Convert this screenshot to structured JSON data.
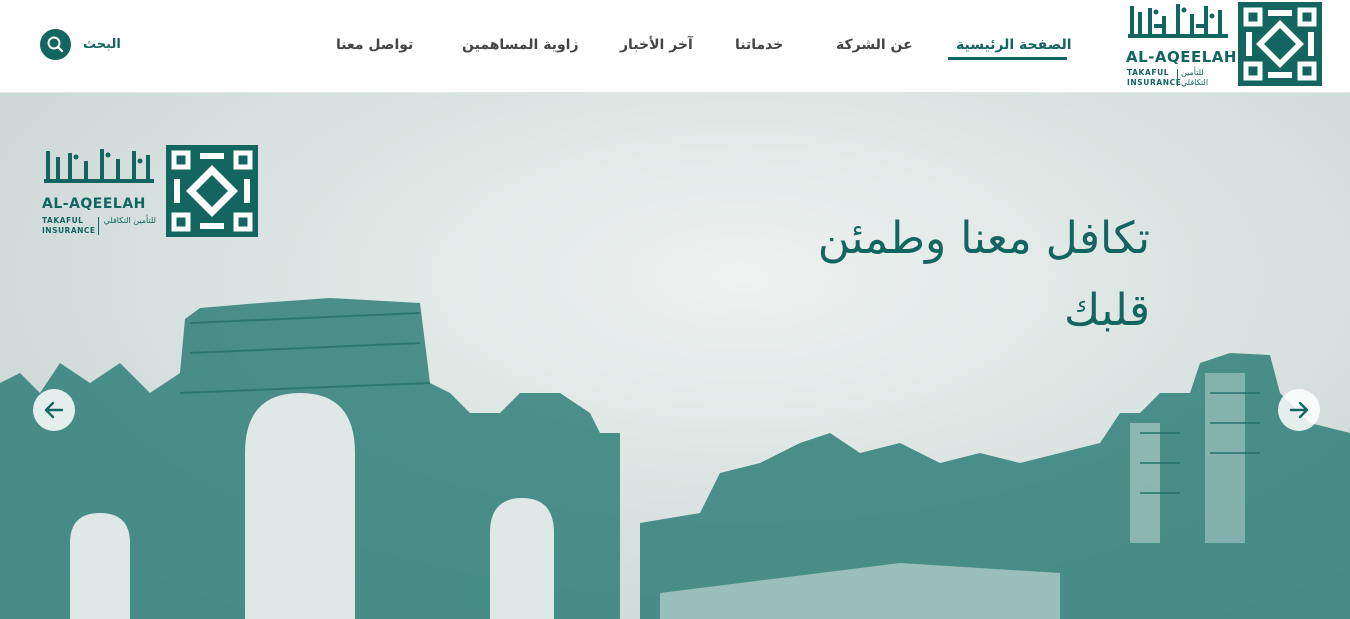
{
  "brand": {
    "name_en": "AL-AQEELAH",
    "name_ar": "العقيلة",
    "sub_en": "TAKAFUL INSURANCE",
    "sub_ar": "للتأمين التكافلي",
    "color": "#13655f"
  },
  "nav": {
    "items": [
      {
        "label": "الصفحة الرئيسية",
        "active": true
      },
      {
        "label": "عن الشركة",
        "active": false
      },
      {
        "label": "خدماتنا",
        "active": false
      },
      {
        "label": "آخر الأخبار",
        "active": false
      },
      {
        "label": "زاوية المساهمين",
        "active": false
      },
      {
        "label": "تواصل معنا",
        "active": false
      }
    ],
    "search_label": "البحث",
    "search_icon": "search-icon"
  },
  "hero": {
    "title_line1": "تكافل معنا وطمئن",
    "title_line2": "قلبك",
    "prev_icon": "arrow-left-icon",
    "next_icon": "arrow-right-icon"
  }
}
